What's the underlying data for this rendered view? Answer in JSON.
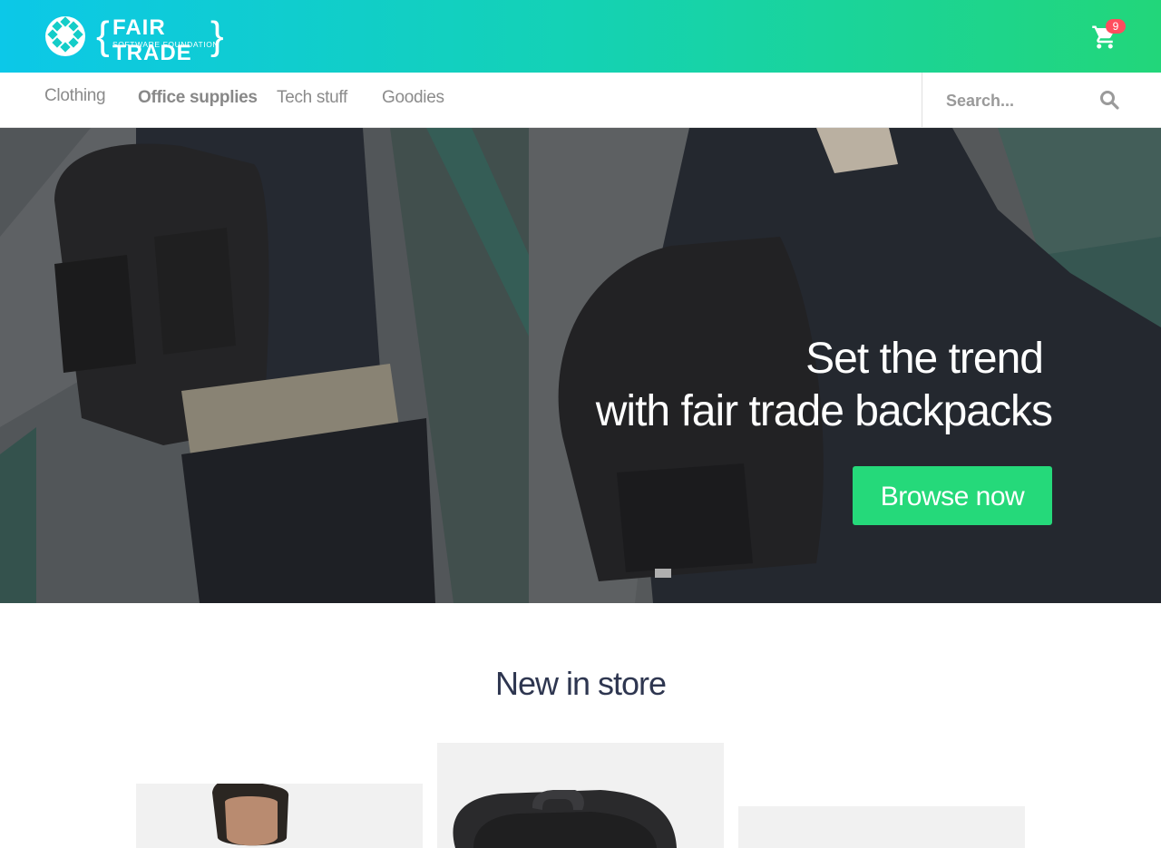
{
  "brand": {
    "logo_title": "FAIR TRADE",
    "logo_subtitle": "SOFTWARE FOUNDATION",
    "gradient_start": "#0cc8e8",
    "gradient_end": "#22d67a"
  },
  "cart": {
    "icon": "shopping-cart-icon",
    "count": "9",
    "badge_color": "#ff4d5e"
  },
  "nav": {
    "items": [
      {
        "label": "Clothing"
      },
      {
        "label": "Office supplies"
      },
      {
        "label": "Tech stuff"
      },
      {
        "label": "Goodies"
      }
    ]
  },
  "search": {
    "placeholder": "Search...",
    "icon": "search-icon"
  },
  "hero": {
    "line1": "Set the trend",
    "line2": "with fair trade backpacks",
    "button_label": "Browse now",
    "accent": "#25d97a"
  },
  "new_in_store": {
    "title": "New in store"
  }
}
